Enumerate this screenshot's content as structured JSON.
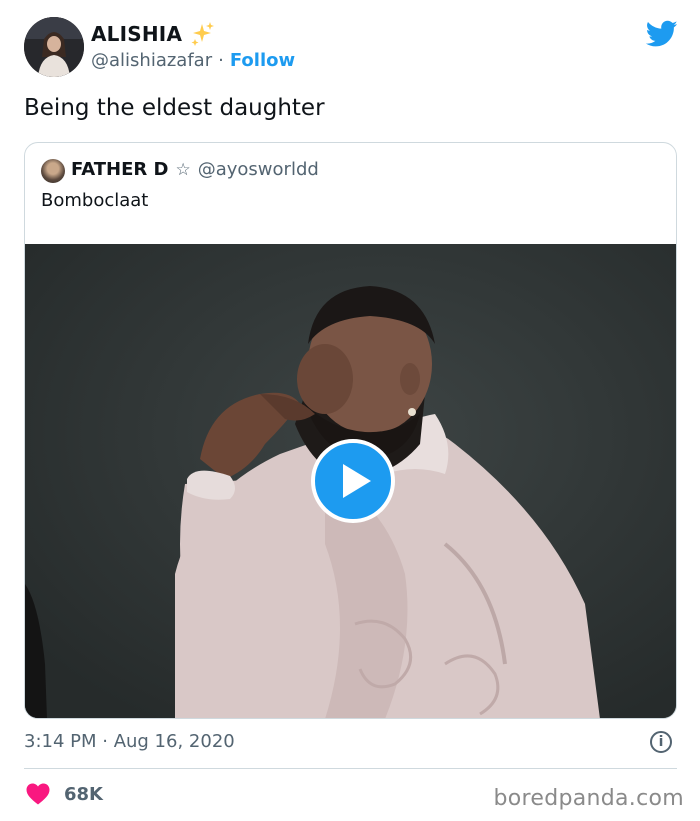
{
  "author": {
    "display_name": "ALISHIA",
    "emoji": "sparkles-icon",
    "handle": "@alishiazafar",
    "separator": "·",
    "follow_label": "Follow"
  },
  "tweet": {
    "text": "Being the eldest daughter",
    "timestamp": "3:14 PM · Aug 16, 2020",
    "likes": "68K"
  },
  "quoted": {
    "display_name": "FATHER D",
    "badge": "☆",
    "handle": "@ayosworldd",
    "text": "Bomboclaat"
  },
  "icons": {
    "brand": "twitter-bird-icon",
    "info": "i",
    "like": "heart-icon",
    "play": "play-icon"
  },
  "watermark": "boredpanda.com",
  "colors": {
    "accent": "#1d9bf0",
    "like": "#f91880",
    "muted": "#536471",
    "text": "#0f1419"
  }
}
